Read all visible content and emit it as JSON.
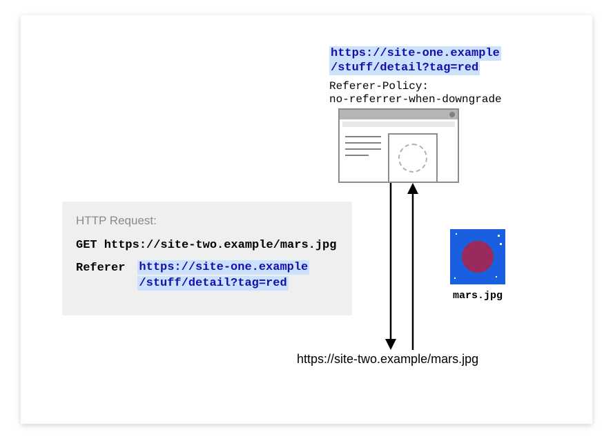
{
  "top_url": {
    "line1": "https://site-one.example",
    "line2": "/stuff/detail?tag=red"
  },
  "policy": {
    "header": "Referer-Policy:",
    "value": "no-referrer-when-downgrade"
  },
  "request": {
    "title": "HTTP Request:",
    "method_line": "GET https://site-two.example/mars.jpg",
    "referer_label": "Referer",
    "referer_url_line1": "https://site-one.example",
    "referer_url_line2": "/stuff/detail?tag=red"
  },
  "mars": {
    "label": "mars.jpg"
  },
  "bottom_url": "https://site-two.example/mars.jpg"
}
